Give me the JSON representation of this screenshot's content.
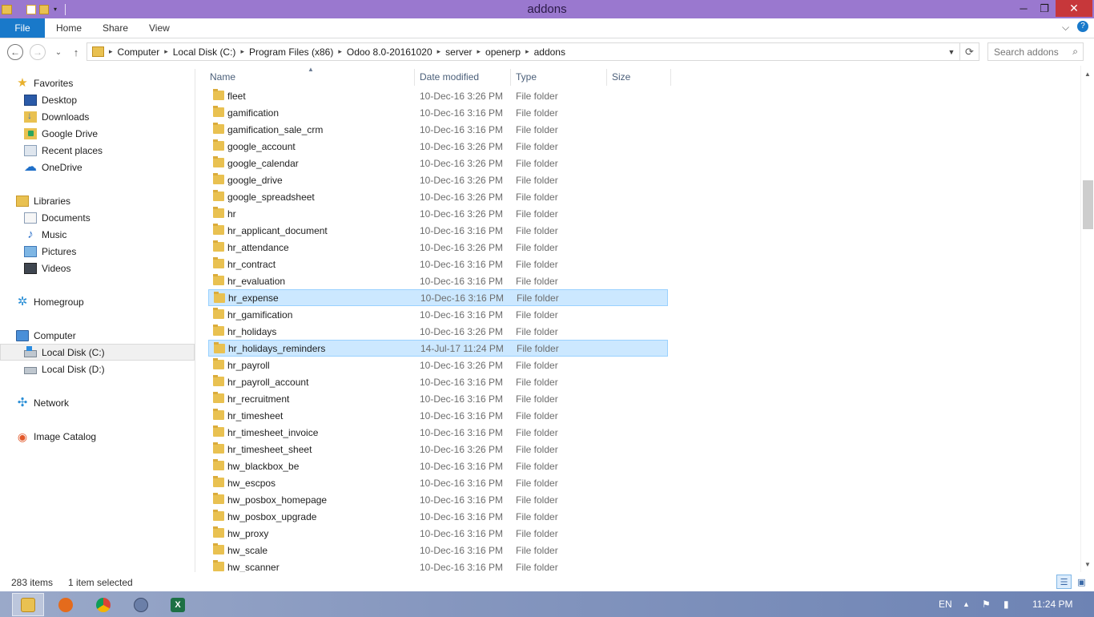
{
  "window": {
    "title": "addons",
    "minimize": "─",
    "restore": "❐",
    "close": "✕"
  },
  "ribbon": {
    "tabs": [
      "File",
      "Home",
      "Share",
      "View"
    ],
    "expand": "⌵",
    "help": "?"
  },
  "nav": {
    "back": "←",
    "forward": "→",
    "recent": "⌄",
    "up": "↑",
    "breadcrumbs": [
      "Computer",
      "Local Disk (C:)",
      "Program Files (x86)",
      "Odoo 8.0-20161020",
      "server",
      "openerp",
      "addons"
    ],
    "search_placeholder": "Search addons"
  },
  "sidebar": {
    "favorites": {
      "label": "Favorites",
      "items": [
        "Desktop",
        "Downloads",
        "Google Drive",
        "Recent places",
        "OneDrive"
      ]
    },
    "libraries": {
      "label": "Libraries",
      "items": [
        "Documents",
        "Music",
        "Pictures",
        "Videos"
      ]
    },
    "homegroup": "Homegroup",
    "computer": {
      "label": "Computer",
      "items": [
        "Local Disk (C:)",
        "Local Disk (D:)"
      ]
    },
    "network": "Network",
    "image_catalog": "Image Catalog"
  },
  "columns": [
    "Name",
    "Date modified",
    "Type",
    "Size"
  ],
  "files": [
    {
      "name": "fleet",
      "date": "10-Dec-16 3:26 PM",
      "type": "File folder"
    },
    {
      "name": "gamification",
      "date": "10-Dec-16 3:16 PM",
      "type": "File folder"
    },
    {
      "name": "gamification_sale_crm",
      "date": "10-Dec-16 3:16 PM",
      "type": "File folder"
    },
    {
      "name": "google_account",
      "date": "10-Dec-16 3:26 PM",
      "type": "File folder"
    },
    {
      "name": "google_calendar",
      "date": "10-Dec-16 3:26 PM",
      "type": "File folder"
    },
    {
      "name": "google_drive",
      "date": "10-Dec-16 3:26 PM",
      "type": "File folder"
    },
    {
      "name": "google_spreadsheet",
      "date": "10-Dec-16 3:26 PM",
      "type": "File folder"
    },
    {
      "name": "hr",
      "date": "10-Dec-16 3:26 PM",
      "type": "File folder"
    },
    {
      "name": "hr_applicant_document",
      "date": "10-Dec-16 3:16 PM",
      "type": "File folder"
    },
    {
      "name": "hr_attendance",
      "date": "10-Dec-16 3:26 PM",
      "type": "File folder"
    },
    {
      "name": "hr_contract",
      "date": "10-Dec-16 3:16 PM",
      "type": "File folder"
    },
    {
      "name": "hr_evaluation",
      "date": "10-Dec-16 3:16 PM",
      "type": "File folder"
    },
    {
      "name": "hr_expense",
      "date": "10-Dec-16 3:16 PM",
      "type": "File folder"
    },
    {
      "name": "hr_gamification",
      "date": "10-Dec-16 3:16 PM",
      "type": "File folder"
    },
    {
      "name": "hr_holidays",
      "date": "10-Dec-16 3:26 PM",
      "type": "File folder"
    },
    {
      "name": "hr_holidays_reminders",
      "date": "14-Jul-17 11:24 PM",
      "type": "File folder"
    },
    {
      "name": "hr_payroll",
      "date": "10-Dec-16 3:26 PM",
      "type": "File folder"
    },
    {
      "name": "hr_payroll_account",
      "date": "10-Dec-16 3:16 PM",
      "type": "File folder"
    },
    {
      "name": "hr_recruitment",
      "date": "10-Dec-16 3:16 PM",
      "type": "File folder"
    },
    {
      "name": "hr_timesheet",
      "date": "10-Dec-16 3:16 PM",
      "type": "File folder"
    },
    {
      "name": "hr_timesheet_invoice",
      "date": "10-Dec-16 3:16 PM",
      "type": "File folder"
    },
    {
      "name": "hr_timesheet_sheet",
      "date": "10-Dec-16 3:26 PM",
      "type": "File folder"
    },
    {
      "name": "hw_blackbox_be",
      "date": "10-Dec-16 3:16 PM",
      "type": "File folder"
    },
    {
      "name": "hw_escpos",
      "date": "10-Dec-16 3:16 PM",
      "type": "File folder"
    },
    {
      "name": "hw_posbox_homepage",
      "date": "10-Dec-16 3:16 PM",
      "type": "File folder"
    },
    {
      "name": "hw_posbox_upgrade",
      "date": "10-Dec-16 3:16 PM",
      "type": "File folder"
    },
    {
      "name": "hw_proxy",
      "date": "10-Dec-16 3:16 PM",
      "type": "File folder"
    },
    {
      "name": "hw_scale",
      "date": "10-Dec-16 3:16 PM",
      "type": "File folder"
    },
    {
      "name": "hw_scanner",
      "date": "10-Dec-16 3:16 PM",
      "type": "File folder"
    }
  ],
  "highlighted_rows": [
    12,
    15
  ],
  "status": {
    "item_count": "283 items",
    "selection": "1 item selected"
  },
  "taskbar": {
    "apps": [
      "file-explorer-icon",
      "firefox-icon",
      "chrome-icon",
      "app-icon",
      "excel-icon"
    ],
    "language": "EN",
    "time": "11:24 PM"
  },
  "colors": {
    "titlebar": "#9a78cf",
    "file_tab": "#1979ca",
    "selection": "#cce8ff",
    "close": "#c7373a"
  }
}
